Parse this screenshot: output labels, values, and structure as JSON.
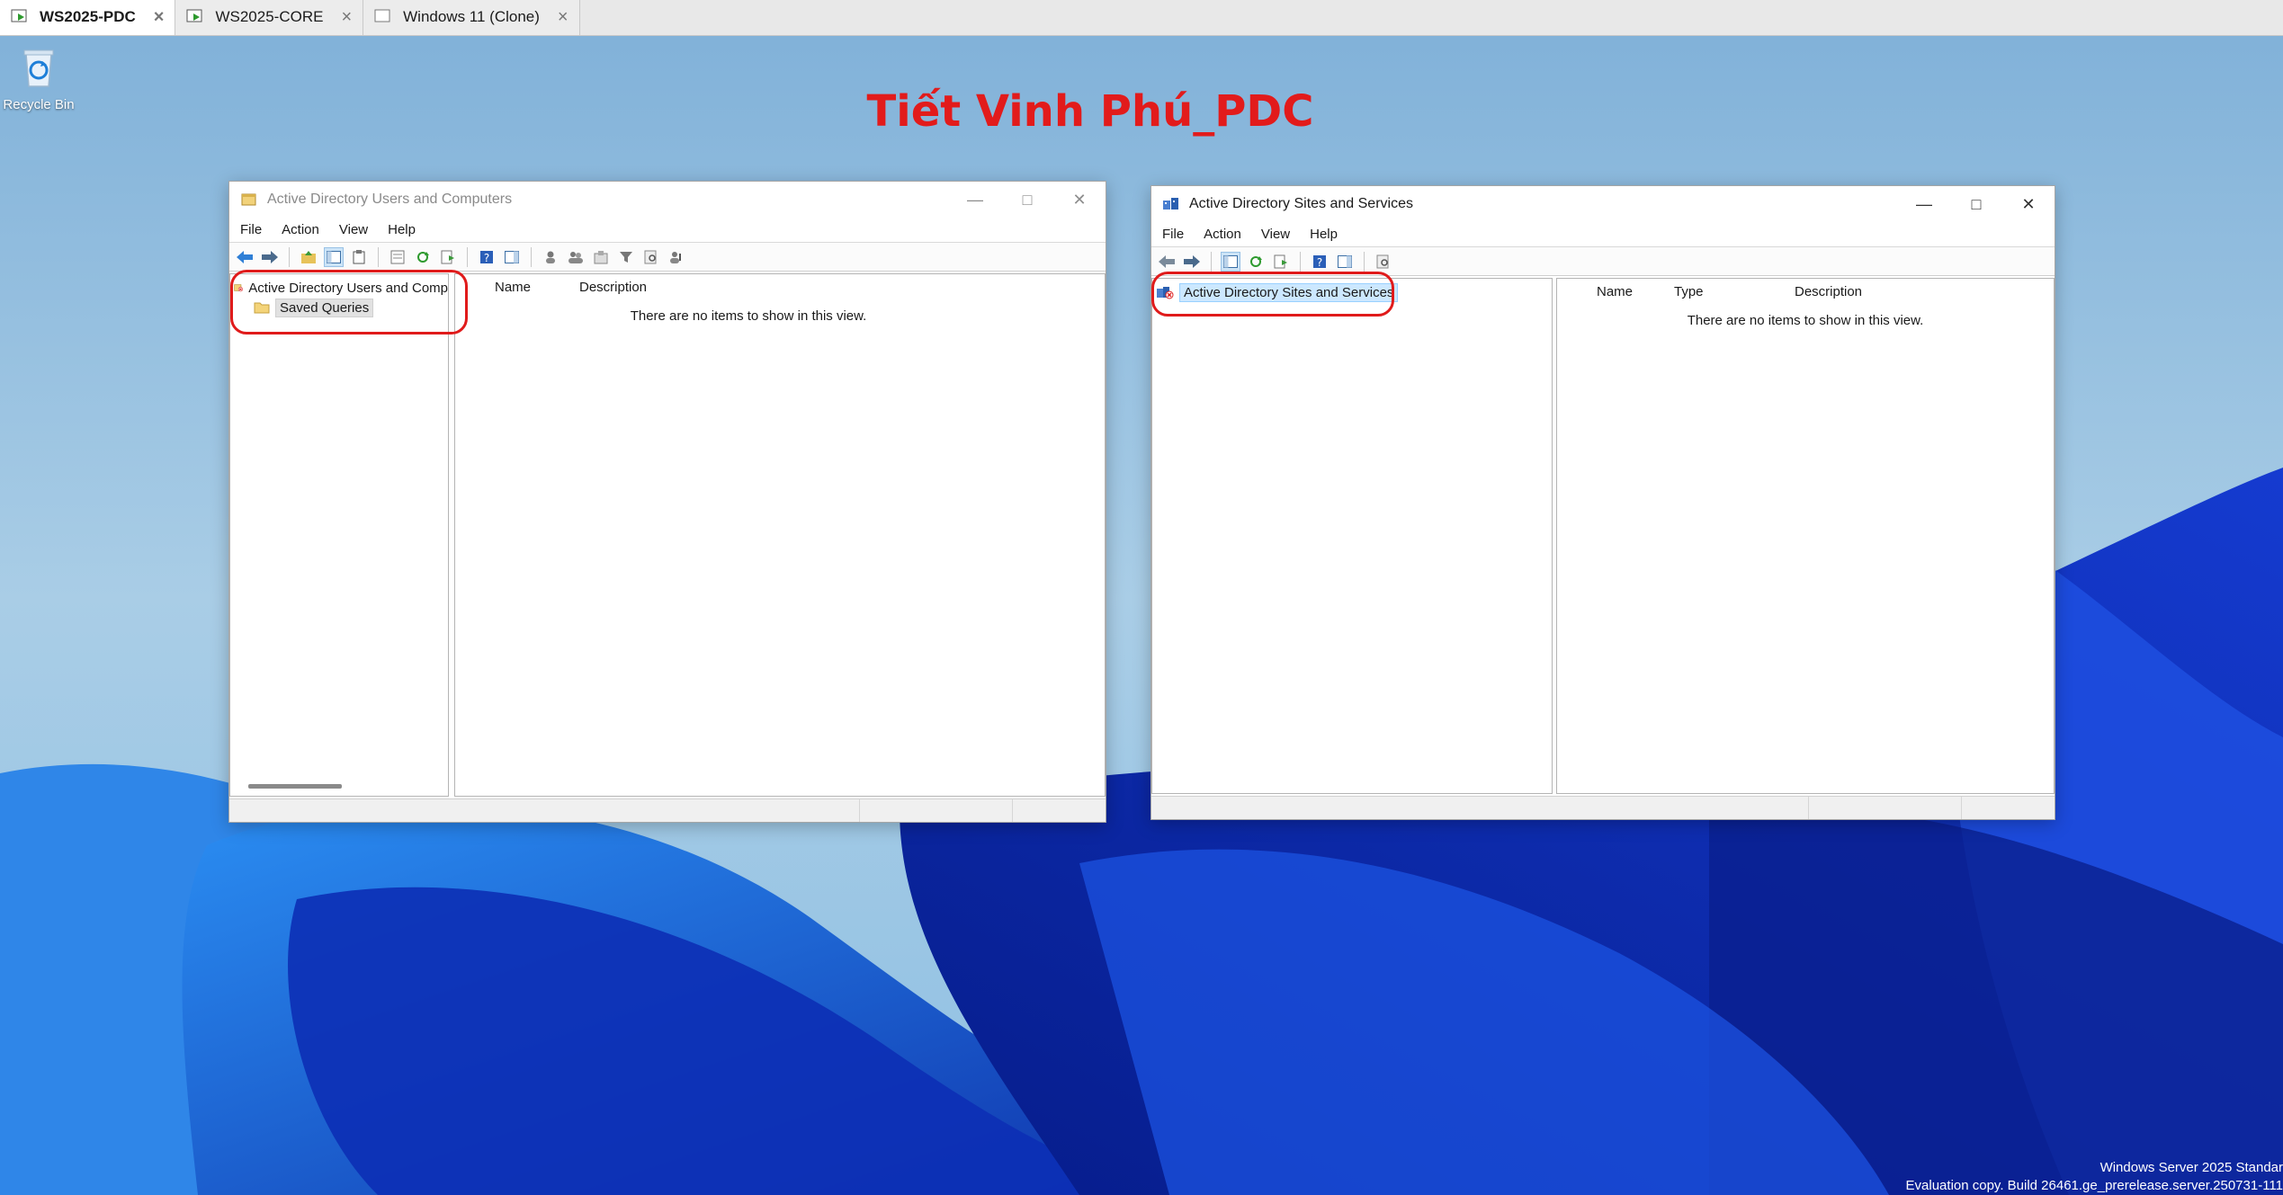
{
  "tabs": [
    {
      "label": "WS2025-PDC",
      "active": true
    },
    {
      "label": "WS2025-CORE",
      "active": false
    },
    {
      "label": "Windows 11 (Clone)",
      "active": false
    }
  ],
  "desktop": {
    "recycle_bin_label": "Recycle Bin",
    "title_overlay": "Tiết Vinh Phú_PDC",
    "title_color": "#e21b1b",
    "watermark_line1": "Windows Server 2025 Standar",
    "watermark_line2": "Evaluation copy. Build 26461.ge_prerelease.server.250731-111"
  },
  "aduc": {
    "title": "Active Directory Users and Computers",
    "menu": [
      "File",
      "Action",
      "View",
      "Help"
    ],
    "tree": {
      "root": "Active Directory Users and Comp",
      "child": "Saved Queries"
    },
    "columns": [
      "Name",
      "Description"
    ],
    "empty_message": "There are no items to show in this view."
  },
  "adss": {
    "title": "Active Directory Sites and Services",
    "menu": [
      "File",
      "Action",
      "View",
      "Help"
    ],
    "tree": {
      "root": "Active Directory Sites and Services"
    },
    "columns": [
      "Name",
      "Type",
      "Description"
    ],
    "empty_message": "There are no items to show in this view."
  },
  "colors": {
    "annotation_red": "#e01b1b",
    "selection_blue": "#cce8ff"
  }
}
